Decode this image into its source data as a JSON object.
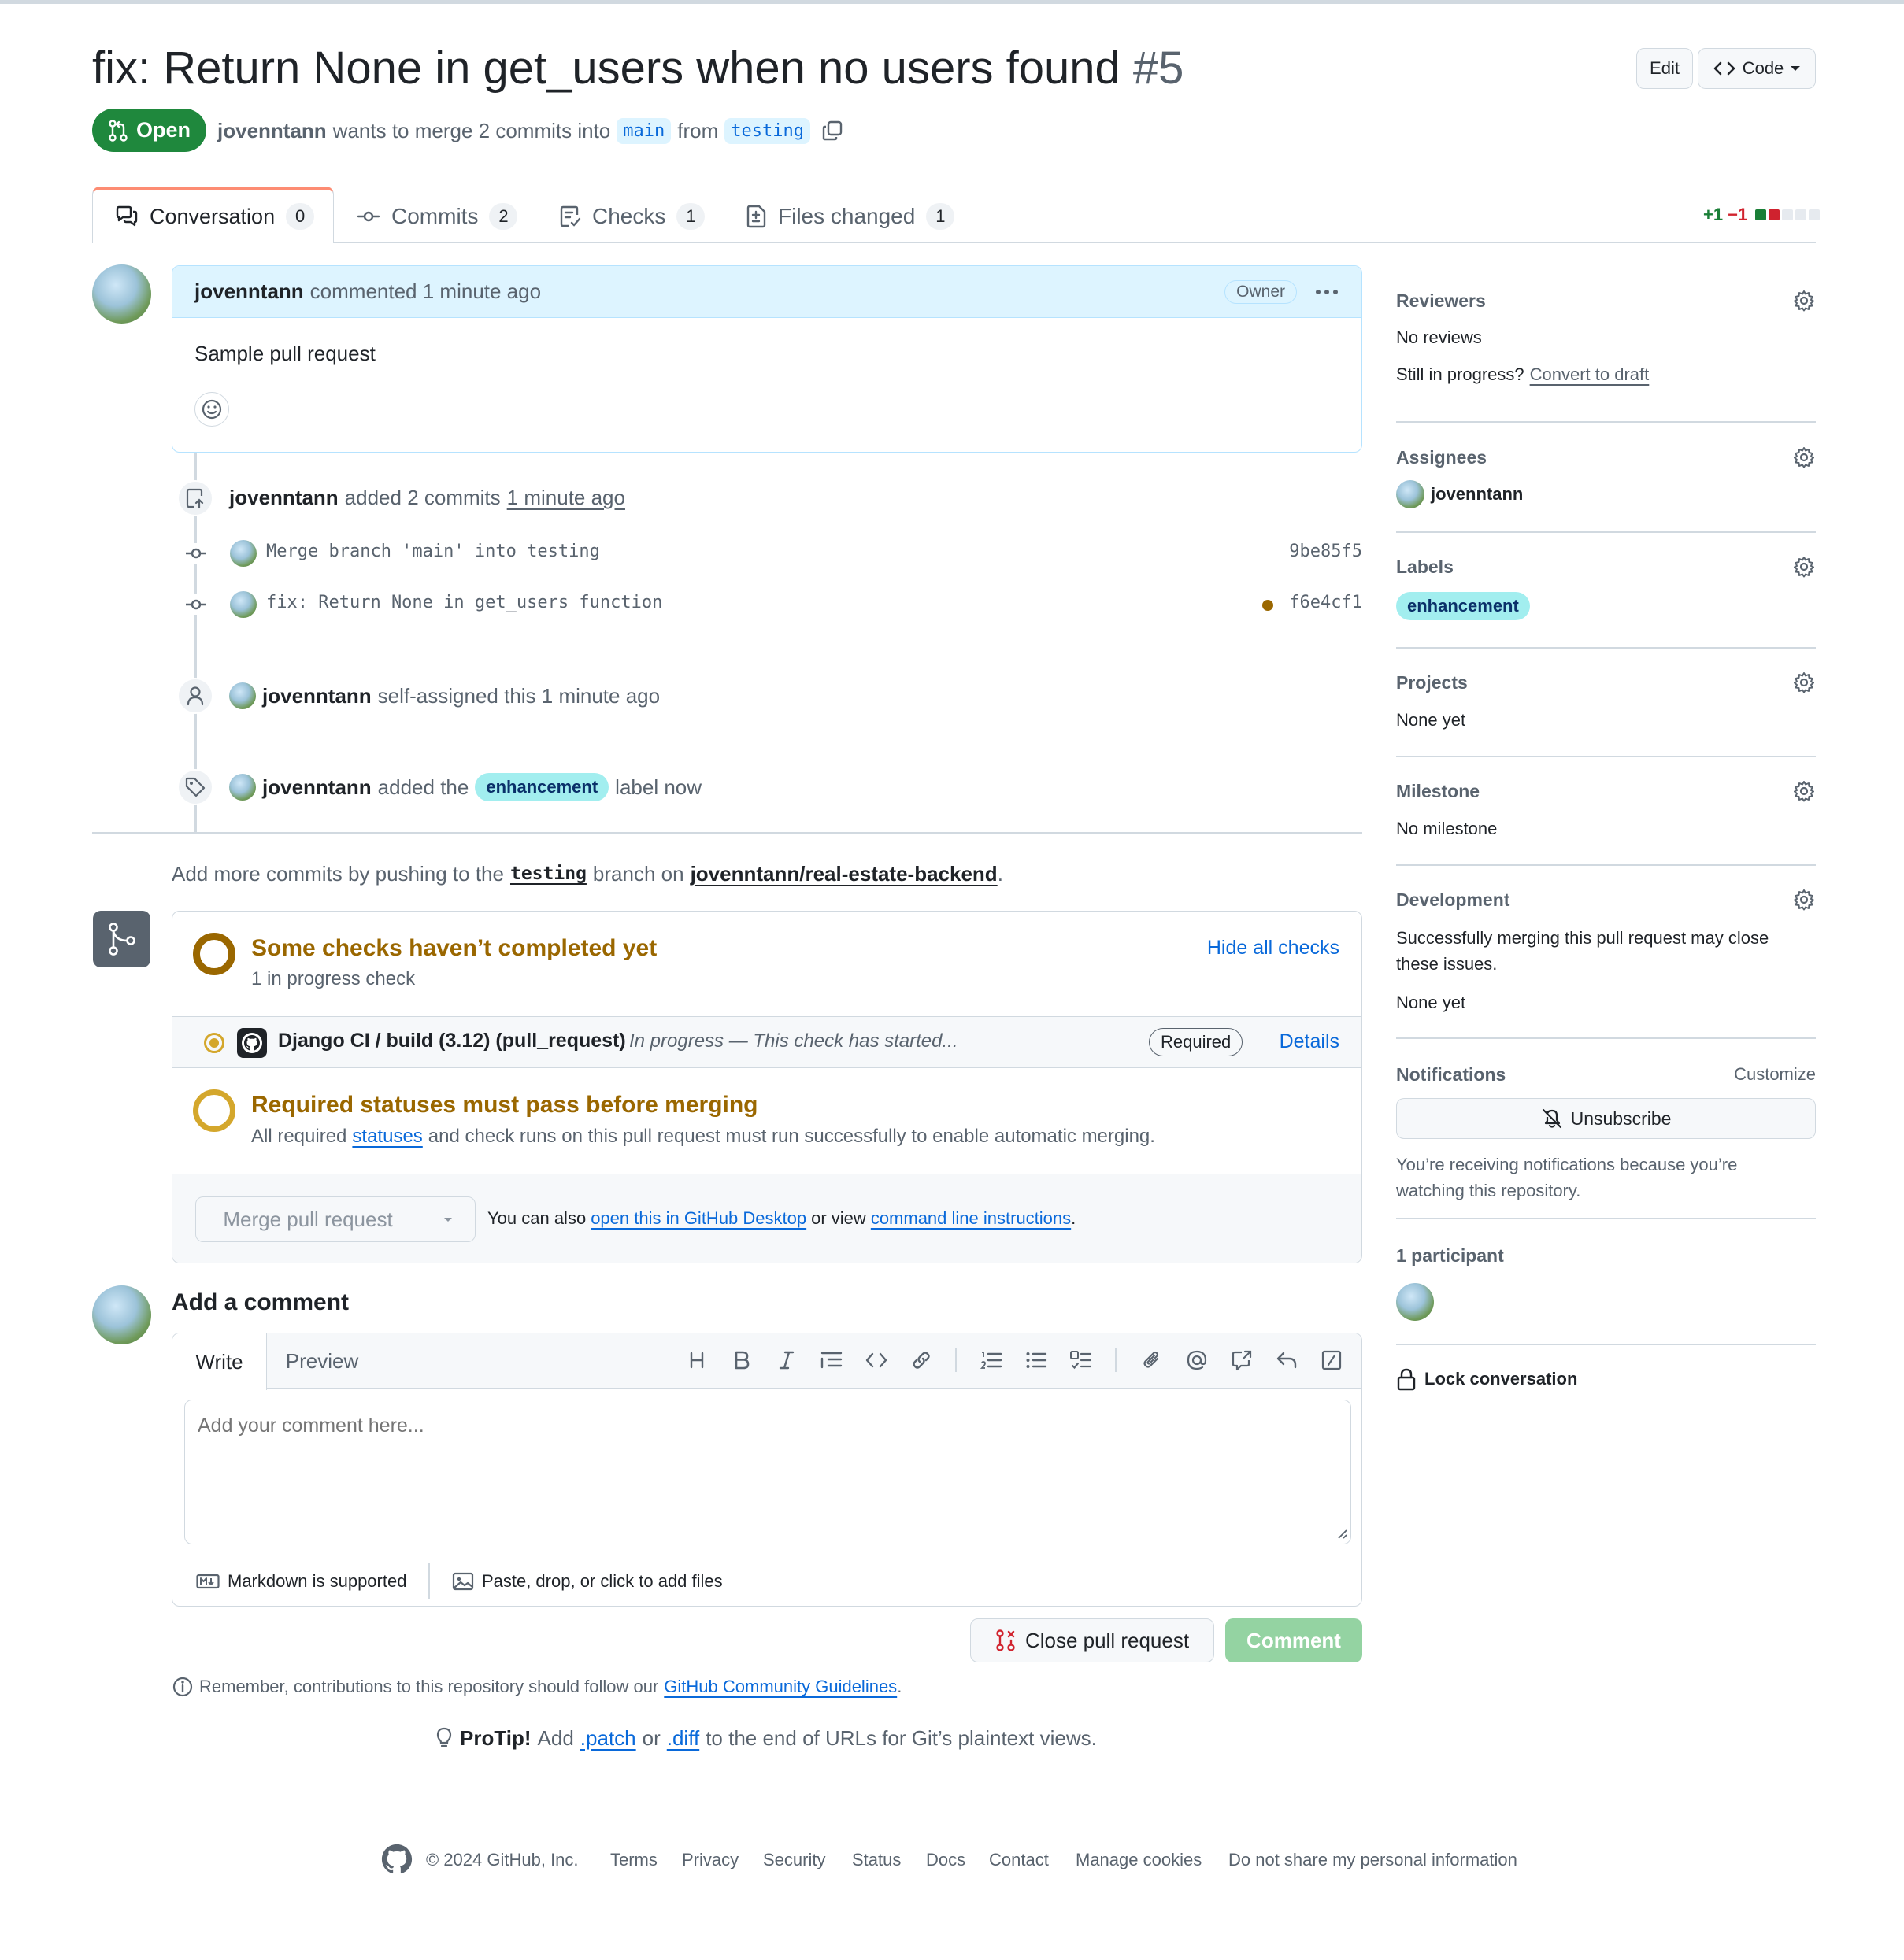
{
  "header": {
    "title": "fix: Return None in get_users when no users found",
    "number": "#5",
    "edit_label": "Edit",
    "code_label": "Code",
    "state_label": "Open",
    "author": "jovenntann",
    "merge_text_1": "wants to merge 2 commits into",
    "base_branch": "main",
    "merge_text_2": "from",
    "head_branch": "testing"
  },
  "tabs": [
    {
      "label": "Conversation",
      "count": "0",
      "icon": "comment-discussion-icon"
    },
    {
      "label": "Commits",
      "count": "2",
      "icon": "git-commit-icon"
    },
    {
      "label": "Checks",
      "count": "1",
      "icon": "checklist-icon"
    },
    {
      "label": "Files changed",
      "count": "1",
      "icon": "file-diff-icon"
    }
  ],
  "diffstat": {
    "added": "+1",
    "removed": "−1"
  },
  "comment": {
    "author": "jovenntann",
    "action": "commented 1 minute ago",
    "role": "Owner",
    "body": "Sample pull request"
  },
  "timeline": {
    "commits_event": {
      "author": "jovenntann",
      "action": "added 2 commits",
      "time": "1 minute ago"
    },
    "commits": [
      {
        "message": "Merge branch 'main' into testing",
        "sha": "9be85f5",
        "status": ""
      },
      {
        "message": "fix: Return None in get_users function",
        "sha": "f6e4cf1",
        "status": "pending"
      }
    ],
    "assign_event": {
      "author": "jovenntann",
      "action": "self-assigned this 1 minute ago"
    },
    "label_event": {
      "author": "jovenntann",
      "action_1": "added the",
      "label": "enhancement",
      "action_2": "label now"
    }
  },
  "push_hint": {
    "text_1": "Add more commits by pushing to the",
    "branch": "testing",
    "text_2": "branch on",
    "repo": "jovenntann/real-estate-backend",
    "text_3": "."
  },
  "checks": {
    "title": "Some checks haven’t completed yet",
    "subtitle": "1 in progress check",
    "hide_label": "Hide all checks",
    "item_name": "Django CI / build (3.12) (pull_request)",
    "item_status": "In progress — This check has started...",
    "required_label": "Required",
    "details_label": "Details",
    "required_title": "Required statuses must pass before merging",
    "required_text_1": "All required",
    "required_link": "statuses",
    "required_text_2": "and check runs on this pull request must run successfully to enable automatic merging.",
    "merge_button": "Merge pull request",
    "merge_hint_1": "You can also",
    "merge_link_1": "open this in GitHub Desktop",
    "merge_hint_2": "or view",
    "merge_link_2": "command line instructions",
    "merge_hint_3": "."
  },
  "add_comment": {
    "heading": "Add a comment",
    "tab_write": "Write",
    "tab_preview": "Preview",
    "placeholder": "Add your comment here...",
    "markdown_label": "Markdown is supported",
    "files_label": "Paste, drop, or click to add files",
    "close_label": "Close pull request",
    "comment_label": "Comment",
    "guidelines_1": "Remember, contributions to this repository should follow our",
    "guidelines_link": "GitHub Community Guidelines",
    "guidelines_2": "."
  },
  "protip": {
    "bold": "ProTip!",
    "text_1": "Add",
    "link_1": ".patch",
    "text_2": "or",
    "link_2": ".diff",
    "text_3": "to the end of URLs for Git’s plaintext views."
  },
  "sidebar": {
    "reviewers": {
      "title": "Reviewers",
      "value": "No reviews",
      "draft_text": "Still in progress?",
      "draft_link": "Convert to draft"
    },
    "assignees": {
      "title": "Assignees",
      "value": "jovenntann"
    },
    "labels": {
      "title": "Labels",
      "value": "enhancement"
    },
    "projects": {
      "title": "Projects",
      "value": "None yet"
    },
    "milestone": {
      "title": "Milestone",
      "value": "No milestone"
    },
    "development": {
      "title": "Development",
      "text": "Successfully merging this pull request may close these issues.",
      "value": "None yet"
    },
    "notifications": {
      "title": "Notifications",
      "customize": "Customize",
      "button": "Unsubscribe",
      "text": "You’re receiving notifications because you’re watching this repository."
    },
    "participants": {
      "title": "1 participant"
    },
    "lock": {
      "label": "Lock conversation"
    }
  },
  "footer": {
    "copyright": "© 2024 GitHub, Inc.",
    "links": [
      "Terms",
      "Privacy",
      "Security",
      "Status",
      "Docs",
      "Contact",
      "Manage cookies",
      "Do not share my personal information"
    ]
  },
  "colors": {
    "open_green": "#1f883d",
    "pending_brown": "#9a6700",
    "link_blue": "#0969da",
    "label_cyan": "#a2eeef",
    "danger_red": "#d1242f"
  }
}
